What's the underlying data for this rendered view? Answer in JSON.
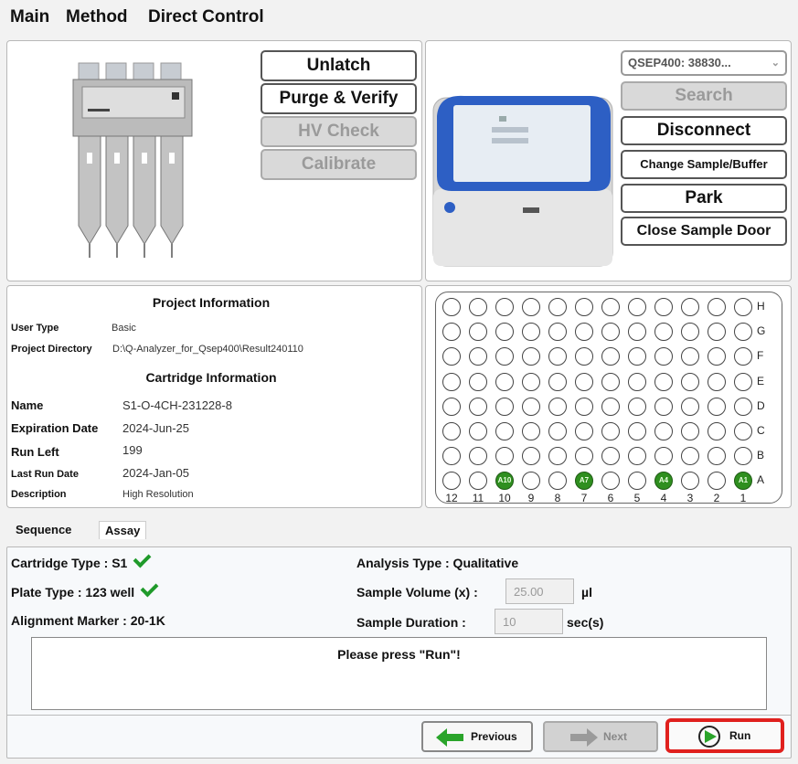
{
  "tabs": [
    "Main",
    "Method",
    "Direct Control"
  ],
  "cartridge_buttons": {
    "unlatch": "Unlatch",
    "purge_verify": "Purge & Verify",
    "hv_check": "HV Check",
    "calibrate": "Calibrate"
  },
  "device": {
    "selector": "QSEP400: 38830...",
    "search": "Search",
    "disconnect": "Disconnect",
    "change_sample": "Change Sample/Buffer",
    "park": "Park",
    "close_door": "Close Sample Door"
  },
  "project_info": {
    "title": "Project Information",
    "user_type_label": "User Type",
    "user_type": "Basic",
    "directory_label": "Project Directory",
    "directory": "D:\\Q-Analyzer_for_Qsep400\\Result240110"
  },
  "cartridge_info": {
    "title": "Cartridge Information",
    "name_label": "Name",
    "name": "S1-O-4CH-231228-8",
    "expiration_label": "Expiration Date",
    "expiration": "2024-Jun-25",
    "run_left_label": "Run Left",
    "run_left": "199",
    "last_run_label": "Last Run Date",
    "last_run": "2024-Jan-05",
    "description_label": "Description",
    "description": "High Resolution"
  },
  "plate": {
    "row_labels": [
      "H",
      "G",
      "F",
      "E",
      "D",
      "C",
      "B",
      "A"
    ],
    "col_labels": [
      "12",
      "11",
      "10",
      "9",
      "8",
      "7",
      "6",
      "5",
      "4",
      "3",
      "2",
      "1"
    ],
    "selected_wells": [
      "A10",
      "A7",
      "A4",
      "A1"
    ]
  },
  "bottom_tabs": [
    "Sequence",
    "Assay"
  ],
  "assay": {
    "cartridge_type": "Cartridge Type : S1",
    "plate_type": "Plate Type : 123 well",
    "alignment_marker": "Alignment Marker : 20-1K",
    "analysis_type": "Analysis Type : Qualitative",
    "sample_volume_label": "Sample Volume (x) :",
    "sample_volume": "25.00",
    "sample_volume_unit": "µl",
    "sample_duration_label": "Sample Duration :",
    "sample_duration": "10",
    "sample_duration_unit": "sec(s)",
    "message": "Please press \"Run\"!"
  },
  "nav": {
    "previous": "Previous",
    "next": "Next",
    "run": "Run"
  },
  "colors": {
    "accent_green": "#1f9a2a",
    "run_highlight": "#e0201e",
    "device_blue": "#2d5fc4"
  }
}
